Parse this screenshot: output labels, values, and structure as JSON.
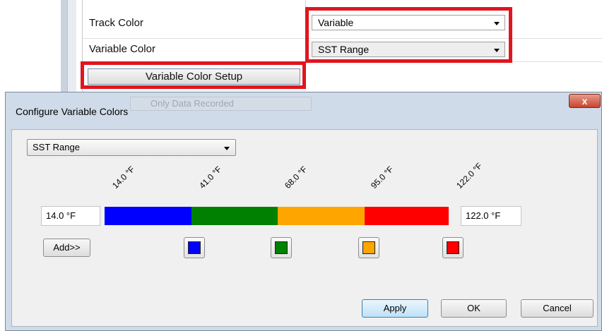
{
  "properties": {
    "track_color": {
      "label": "Track Color",
      "value": "Variable"
    },
    "variable_color": {
      "label": "Variable Color",
      "value": "SST Range"
    },
    "setup_button": "Variable Color Setup",
    "highlight_color": "#e0151e"
  },
  "dialog": {
    "title": "Configure Variable Colors",
    "background_button": "Only Data Recorded",
    "close_glyph": "x",
    "range_select": "SST Range",
    "min_temp": "14.0 °F",
    "max_temp": "122.0 °F",
    "tick_labels": [
      "14.0 °F",
      "41.0 °F",
      "68.0 °F",
      "95.0 °F",
      "122.0 °F"
    ],
    "segments": [
      {
        "color": "#0000ff",
        "name": "blue"
      },
      {
        "color": "#008000",
        "name": "green"
      },
      {
        "color": "#ffa500",
        "name": "orange"
      },
      {
        "color": "#ff0000",
        "name": "red"
      }
    ],
    "add_button": "Add>>",
    "apply_button": "Apply",
    "ok_button": "OK",
    "cancel_button": "Cancel"
  }
}
